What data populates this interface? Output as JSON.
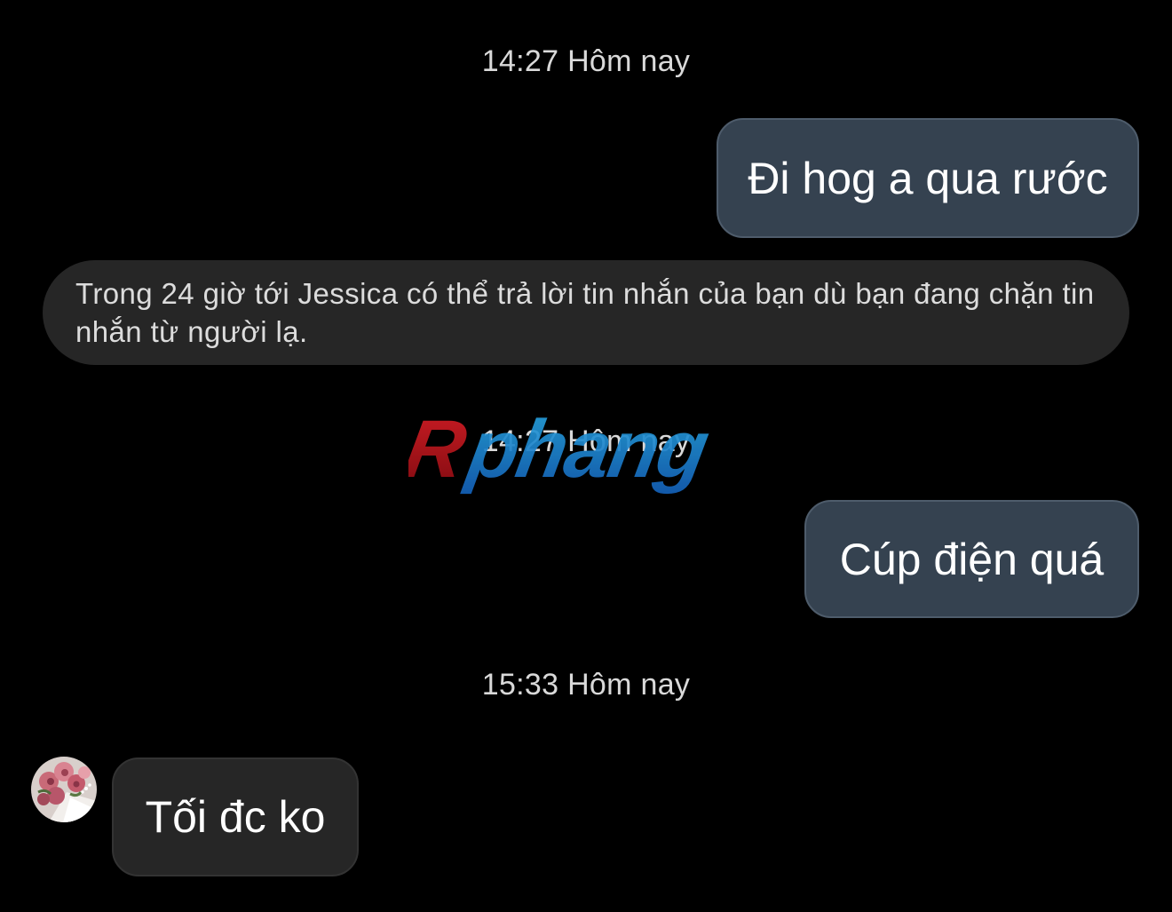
{
  "conversation": {
    "timestamps": [
      "14:27 Hôm nay",
      "14:27 Hôm nay",
      "15:33 Hôm nay"
    ],
    "messages": [
      {
        "direction": "outgoing",
        "text": "Đi hog a qua rước"
      },
      {
        "direction": "outgoing",
        "text": "Cúp điện quá"
      },
      {
        "direction": "incoming",
        "text": "Tối đc ko"
      }
    ],
    "notice": "Trong 24 giờ tới Jessica có thể trả lời tin nhắn của bạn dù bạn đang chặn tin nhắn từ người lạ.",
    "avatar_icon": "flower-bouquet-avatar-icon"
  },
  "watermark": {
    "text": "Rphang",
    "colors": [
      "#c4151c",
      "#1560c8",
      "#1c9ad6"
    ]
  },
  "theme": {
    "background": "#000000",
    "outgoing_bubble": "#354250",
    "incoming_bubble": "#262626"
  }
}
